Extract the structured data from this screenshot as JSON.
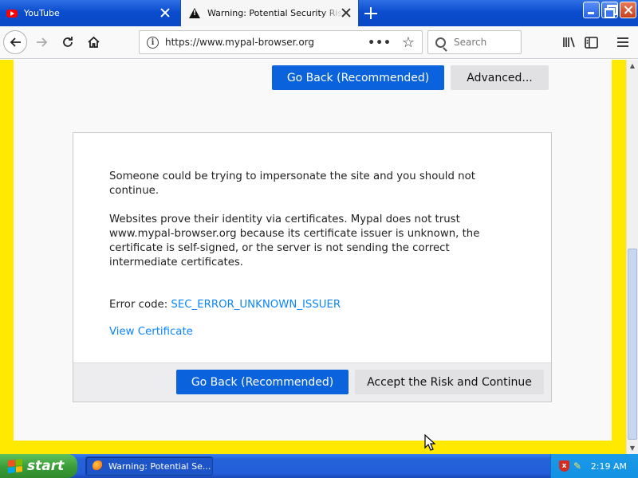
{
  "browser": {
    "tabs": [
      {
        "label": "YouTube",
        "active": false
      },
      {
        "label": "Warning: Potential Security Risk Ahead",
        "active": true
      }
    ],
    "url": "https://www.mypal-browser.org",
    "search_placeholder": "Search"
  },
  "page": {
    "top_go_back": "Go Back (Recommended)",
    "advanced": "Advanced...",
    "paragraph1": "Someone could be trying to impersonate the site and you should not continue.",
    "paragraph2": "Websites prove their identity via certificates. Mypal does not trust www.mypal-browser.org because its certificate issuer is unknown, the certificate is self-signed, or the server is not sending the correct intermediate certificates.",
    "error_prefix": "Error code: ",
    "error_code": "SEC_ERROR_UNKNOWN_ISSUER",
    "view_certificate": "View Certificate",
    "footer_go_back": "Go Back (Recommended)",
    "accept_risk": "Accept the Risk and Continue"
  },
  "taskbar": {
    "start_label": "start",
    "task_item": "Warning: Potential Se...",
    "clock": "2:19 AM"
  },
  "colors": {
    "accent": "#0a63dc",
    "link": "#0a84ff",
    "page_border": "#ffe900"
  }
}
